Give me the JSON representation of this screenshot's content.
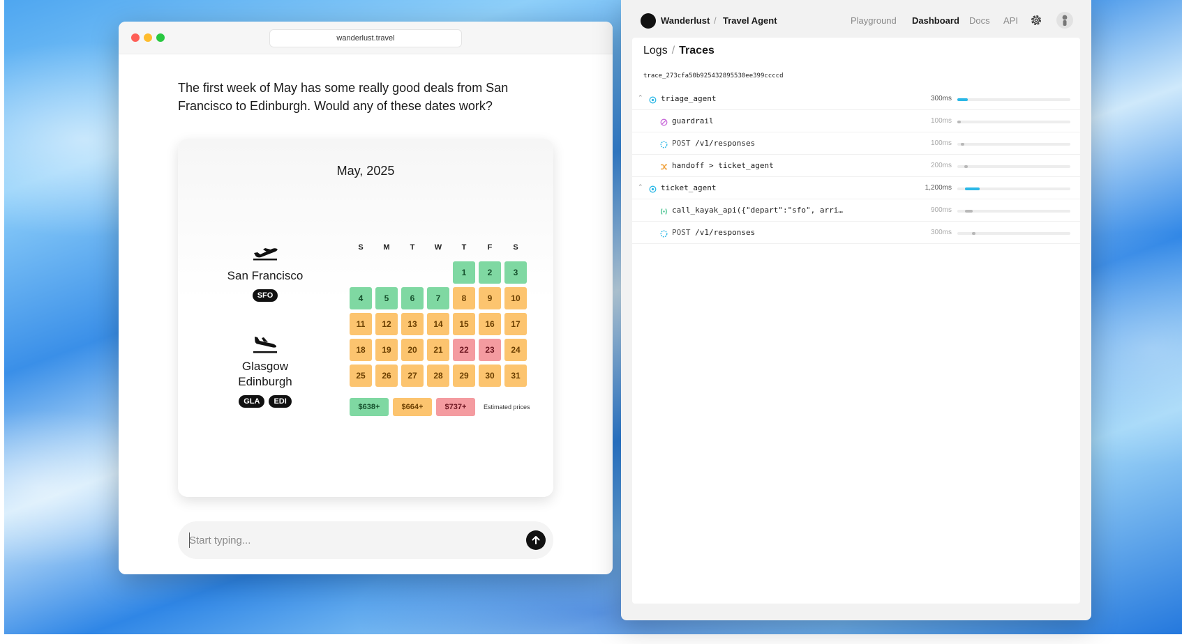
{
  "browser": {
    "url": "wanderlust.travel",
    "message": "The first week of May has some really good deals from San Francisco to Edinburgh. Would any of these dates work?",
    "composer_placeholder": "Start typing..."
  },
  "calendar": {
    "month_label": "May, 2025",
    "weekdays": [
      "S",
      "M",
      "T",
      "W",
      "T",
      "F",
      "S"
    ],
    "leading_blanks": 4,
    "days": [
      {
        "d": "1",
        "tier": "green"
      },
      {
        "d": "2",
        "tier": "green"
      },
      {
        "d": "3",
        "tier": "green"
      },
      {
        "d": "4",
        "tier": "green"
      },
      {
        "d": "5",
        "tier": "green"
      },
      {
        "d": "6",
        "tier": "green"
      },
      {
        "d": "7",
        "tier": "green"
      },
      {
        "d": "8",
        "tier": "orange"
      },
      {
        "d": "9",
        "tier": "orange"
      },
      {
        "d": "10",
        "tier": "orange"
      },
      {
        "d": "11",
        "tier": "orange"
      },
      {
        "d": "12",
        "tier": "orange"
      },
      {
        "d": "13",
        "tier": "orange"
      },
      {
        "d": "14",
        "tier": "orange"
      },
      {
        "d": "15",
        "tier": "orange"
      },
      {
        "d": "16",
        "tier": "orange"
      },
      {
        "d": "17",
        "tier": "orange"
      },
      {
        "d": "18",
        "tier": "orange"
      },
      {
        "d": "19",
        "tier": "orange"
      },
      {
        "d": "20",
        "tier": "orange"
      },
      {
        "d": "21",
        "tier": "orange"
      },
      {
        "d": "22",
        "tier": "red"
      },
      {
        "d": "23",
        "tier": "red"
      },
      {
        "d": "24",
        "tier": "orange"
      },
      {
        "d": "25",
        "tier": "orange"
      },
      {
        "d": "26",
        "tier": "orange"
      },
      {
        "d": "27",
        "tier": "orange"
      },
      {
        "d": "28",
        "tier": "orange"
      },
      {
        "d": "29",
        "tier": "orange"
      },
      {
        "d": "30",
        "tier": "orange"
      },
      {
        "d": "31",
        "tier": "orange"
      }
    ],
    "legend": {
      "green": "$638+",
      "orange": "$664+",
      "red": "$737+",
      "note": "Estimated prices"
    },
    "tier_colors": {
      "green": "#7fd8a2",
      "orange": "#fcc46f",
      "red": "#f49ba0"
    }
  },
  "route": {
    "origin": {
      "city": "San Francisco",
      "codes": [
        "SFO"
      ],
      "icon": "departure-plane-icon"
    },
    "destination": {
      "city_line1": "Glasgow",
      "city_line2": "Edinburgh",
      "codes": [
        "GLA",
        "EDI"
      ],
      "icon": "arrival-plane-icon"
    }
  },
  "dashboard": {
    "brand": "Wanderlust",
    "separator": "/",
    "project": "Travel Agent",
    "nav": [
      "Playground",
      "Dashboard",
      "Docs",
      "API"
    ],
    "active_nav": "Dashboard",
    "breadcrumb": {
      "first": "Logs",
      "sep": "/",
      "second": "Traces"
    },
    "trace_id": "trace_273cfa50b925432895530ee399ccccd",
    "accent_color": "#2bb7e6",
    "spans": [
      {
        "depth": 0,
        "name": "triage_agent",
        "duration": "300ms",
        "icon": "agent-icon",
        "icon_color": "#2bb7e6",
        "bar_start": 0.0,
        "bar_frac": 0.09,
        "bar_color": "blue",
        "collapsible": true
      },
      {
        "depth": 1,
        "name": "guardrail",
        "duration": "100ms",
        "icon": "guardrail-icon",
        "icon_color": "#c86bd9",
        "bar_start": 0.0,
        "bar_frac": 0.03,
        "bar_color": "gray",
        "collapsible": false
      },
      {
        "depth": 1,
        "method": "POST",
        "name": "/v1/responses",
        "duration": "100ms",
        "icon": "response-icon",
        "icon_color": "#2bb7e6",
        "bar_start": 0.03,
        "bar_frac": 0.03,
        "bar_color": "gray",
        "collapsible": false
      },
      {
        "depth": 1,
        "name": "handoff > ticket_agent",
        "duration": "200ms",
        "icon": "handoff-icon",
        "icon_color": "#f0a13b",
        "bar_start": 0.06,
        "bar_frac": 0.03,
        "bar_color": "gray",
        "collapsible": false
      },
      {
        "depth": 0,
        "name": "ticket_agent",
        "duration": "1,200ms",
        "icon": "agent-icon",
        "icon_color": "#2bb7e6",
        "bar_start": 0.07,
        "bar_frac": 0.13,
        "bar_color": "blue",
        "collapsible": true
      },
      {
        "depth": 1,
        "name": "call_kayak_api({\"depart\":\"sfo\", arri…",
        "duration": "900ms",
        "icon": "function-icon",
        "icon_color": "#3fbf8a",
        "bar_start": 0.07,
        "bar_frac": 0.07,
        "bar_color": "gray",
        "collapsible": false
      },
      {
        "depth": 1,
        "method": "POST",
        "name": "/v1/responses",
        "duration": "300ms",
        "icon": "response-icon",
        "icon_color": "#2bb7e6",
        "bar_start": 0.13,
        "bar_frac": 0.03,
        "bar_color": "gray",
        "collapsible": false
      }
    ]
  }
}
